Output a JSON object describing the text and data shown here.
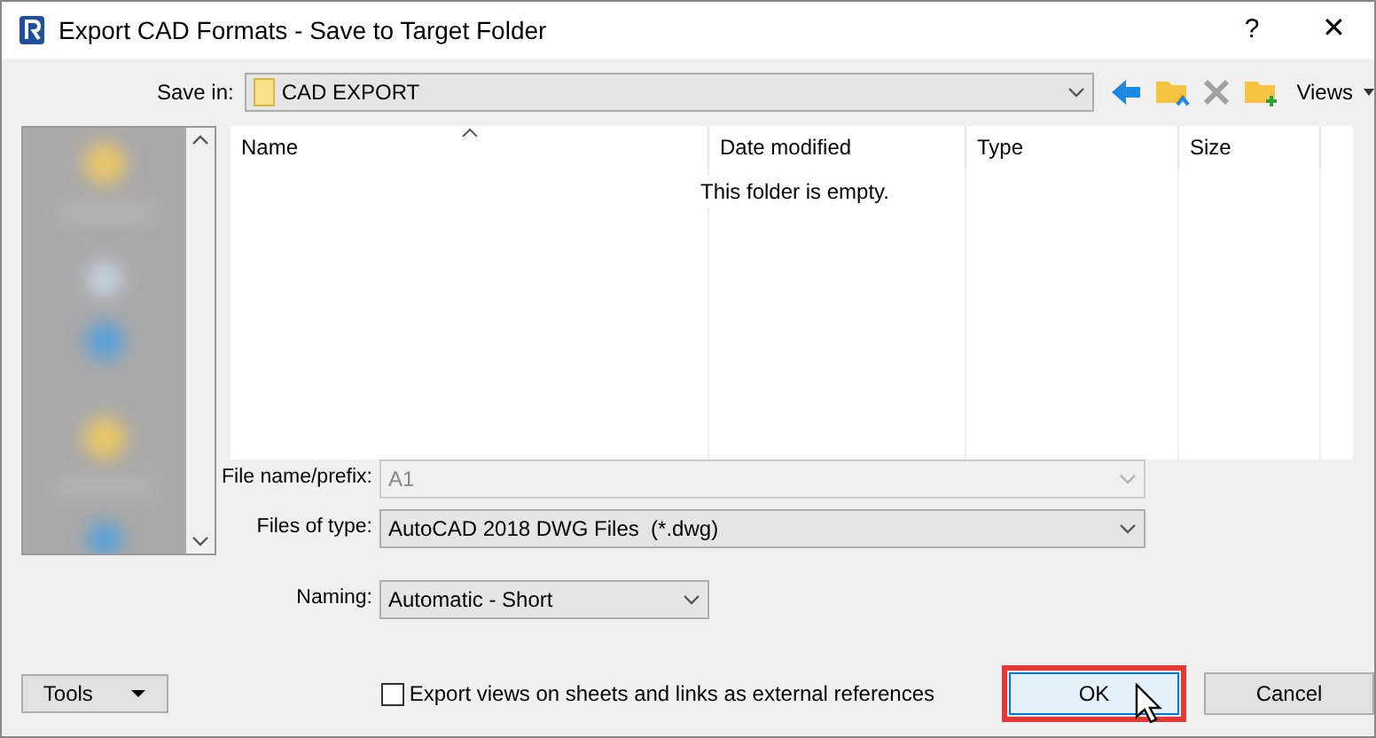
{
  "window": {
    "title": "Export CAD Formats - Save to Target Folder",
    "help": "?",
    "close": "✕"
  },
  "save_in": {
    "label": "Save in:",
    "value": "CAD EXPORT"
  },
  "toolbar": {
    "views": "Views"
  },
  "file_list": {
    "columns": [
      "Name",
      "Date modified",
      "Type",
      "Size"
    ],
    "empty_message": "This folder is empty."
  },
  "fields": [
    {
      "label": "File name/prefix:",
      "value": "A1",
      "disabled": true
    },
    {
      "label": "Files of type:",
      "value": "AutoCAD 2018 DWG Files  (*.dwg)",
      "disabled": false
    },
    {
      "label": "Naming:",
      "value": "Automatic - Short",
      "disabled": false
    }
  ],
  "tools_button": "Tools",
  "export_option": {
    "label": "Export views on sheets and links as external references",
    "checked": false
  },
  "buttons": [
    {
      "label": "OK",
      "highlighted": true
    },
    {
      "label": "Cancel",
      "highlighted": false
    }
  ]
}
